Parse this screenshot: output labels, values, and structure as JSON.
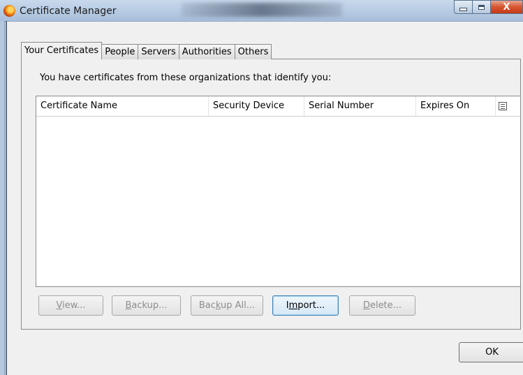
{
  "window": {
    "title": "Certificate Manager",
    "close_glyph": "X"
  },
  "tabs": [
    {
      "label": "Your Certificates",
      "selected": true
    },
    {
      "label": "People",
      "selected": false
    },
    {
      "label": "Servers",
      "selected": false
    },
    {
      "label": "Authorities",
      "selected": false
    },
    {
      "label": "Others",
      "selected": false
    }
  ],
  "panel": {
    "intro": "You have certificates from these organizations that identify you:",
    "columns": [
      "Certificate Name",
      "Security Device",
      "Serial Number",
      "Expires On"
    ],
    "rows": []
  },
  "buttons": {
    "view": {
      "pre": "",
      "key": "V",
      "post": "iew...",
      "enabled": false
    },
    "backup": {
      "pre": "",
      "key": "B",
      "post": "ackup...",
      "enabled": false
    },
    "backup_all": {
      "pre": "Bac",
      "key": "k",
      "post": "up All...",
      "enabled": false
    },
    "import": {
      "pre": "I",
      "key": "m",
      "post": "port...",
      "enabled": true
    },
    "delete": {
      "pre": "",
      "key": "D",
      "post": "elete...",
      "enabled": false
    },
    "ok": "OK"
  },
  "colors": {
    "titlebar": "#b9cde4",
    "dialog_bg": "#f0f0f0",
    "close_button": "#d7542f",
    "focus_border": "#3c7fb1"
  }
}
